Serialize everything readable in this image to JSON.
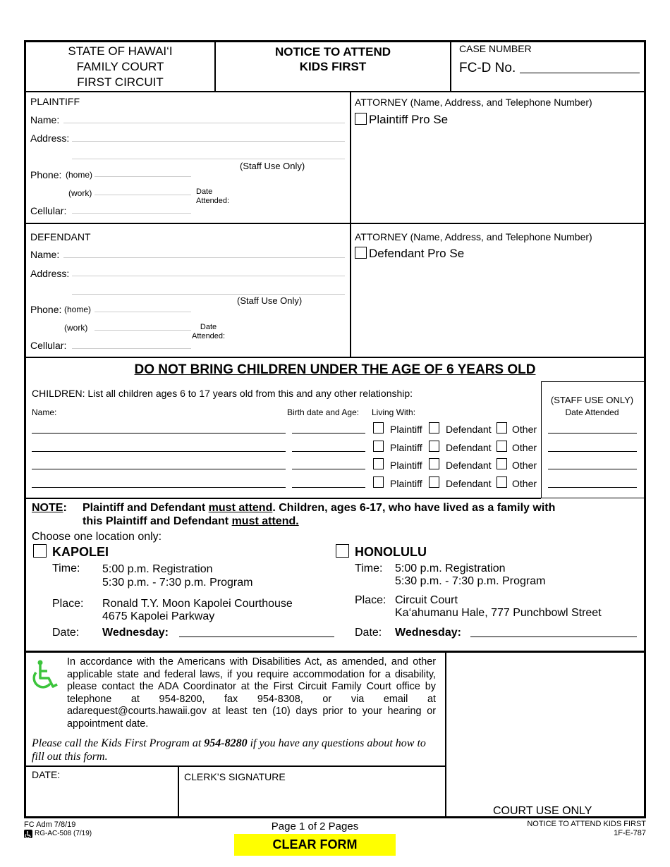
{
  "header": {
    "court_lines": [
      "STATE OF HAWAI‘I",
      "FAMILY COURT",
      "FIRST CIRCUIT"
    ],
    "title_lines": [
      "NOTICE TO ATTEND",
      "KIDS FIRST"
    ],
    "case_number_label": "CASE NUMBER",
    "case_prefix": "FC-D No.",
    "case_number_value": ""
  },
  "plaintiff": {
    "section_label": "PLAINTIFF",
    "name_label": "Name:",
    "address_label": "Address:",
    "phone_label": "Phone:",
    "home_label": "(home)",
    "work_label": "(work)",
    "cellular_label": "Cellular:",
    "staff_use_label": "(Staff Use Only)",
    "date_label": "Date",
    "attended_label": "Attended:",
    "attorney_label": "ATTORNEY  (Name, Address, and Telephone Number)",
    "pro_se_label": "Plaintiff Pro Se"
  },
  "defendant": {
    "section_label": "DEFENDANT",
    "name_label": "Name:",
    "address_label": "Address:",
    "phone_label": "Phone:",
    "home_label": "(home)",
    "work_label": "(work)",
    "cellular_label": "Cellular:",
    "staff_use_label": "(Staff Use Only)",
    "date_label": "Date",
    "attended_label": "Attended:",
    "attorney_label": "ATTORNEY  (Name, Address, and Telephone Number)",
    "pro_se_label": "Defendant Pro Se"
  },
  "children": {
    "warning": "DO NOT BRING CHILDREN UNDER THE AGE OF 6 YEARS OLD",
    "instruction": "CHILDREN:  List all children ages 6 to 17 years old from this and any other relationship:",
    "name_header": "Name:",
    "birth_header": "Birth date and Age:",
    "living_header": "Living With:",
    "staff_header": "(STAFF USE ONLY)",
    "date_attended_header": "Date Attended",
    "options": [
      "Plaintiff",
      "Defendant",
      "Other"
    ],
    "rows": [
      {
        "name": "",
        "birth": "",
        "date_attended": ""
      },
      {
        "name": "",
        "birth": "",
        "date_attended": ""
      },
      {
        "name": "",
        "birth": "",
        "date_attended": ""
      },
      {
        "name": "",
        "birth": "",
        "date_attended": ""
      }
    ]
  },
  "note": {
    "label": "NOTE",
    "colon": ":",
    "line1_a": "Plaintiff and Defendant ",
    "line1_u": "must attend",
    "line1_b": ".  Children, ages 6-17, who have lived as a family with",
    "line2_a": "this Plaintiff and Defendant ",
    "line2_u": "must attend."
  },
  "locations": {
    "choose_label": "Choose one location only:",
    "kapolei": {
      "name": "KAPOLEI",
      "time_label": "Time:",
      "time_line1": "5:00 p.m.  Registration",
      "time_line2": "5:30 p.m. - 7:30 p.m. Program",
      "place_label": "Place:",
      "place_line1": "Ronald T.Y. Moon Kapolei Courthouse",
      "place_line2": "4675 Kapolei Parkway",
      "date_label": "Date:",
      "day_label": "Wednesday:",
      "date_value": ""
    },
    "honolulu": {
      "name": "HONOLULU",
      "time_label": "Time:",
      "time_line1": "5:00 p.m.  Registration",
      "time_line2": "5:30 p.m. - 7:30 p.m. Program",
      "place_label": "Place:",
      "place_line1": "Circuit Court",
      "place_line2": "Ka‘ahumanu Hale, 777 Punchbowl Street",
      "date_label": "Date:",
      "day_label": "Wednesday:",
      "date_value": ""
    }
  },
  "ada": {
    "icon": "wheelchair-accessibility-icon",
    "icon_color": "#3cc43c",
    "text": "In accordance with the Americans with Disabilities Act, as amended, and other applicable state and federal laws, if you require accommodation for a disability, please contact the ADA Coordinator at the First Circuit Family Court office by telephone at 954-8200, fax 954-8308, or via email at adarequest@courts.hawaii.gov at least ten (10) days prior to your hearing or appointment date.",
    "call_a": "Please call the Kids First Program at ",
    "call_phone": "954-8280",
    "call_b": " if you have any questions about how to fill out this form."
  },
  "signature": {
    "date_label": "DATE:",
    "clerk_label": "CLERK’S SIGNATURE",
    "court_use_label": "COURT USE ONLY"
  },
  "footer": {
    "form_code": "FC Adm 7/8/19",
    "rg_code": "RG-AC-508 (7/19)",
    "page_text": "Page 1 of 2 Pages",
    "form_title": "NOTICE TO ATTEND KIDS FIRST",
    "form_id": "1F-E-787",
    "clear_button": "CLEAR FORM",
    "clear_button_color": "#ffff00"
  }
}
